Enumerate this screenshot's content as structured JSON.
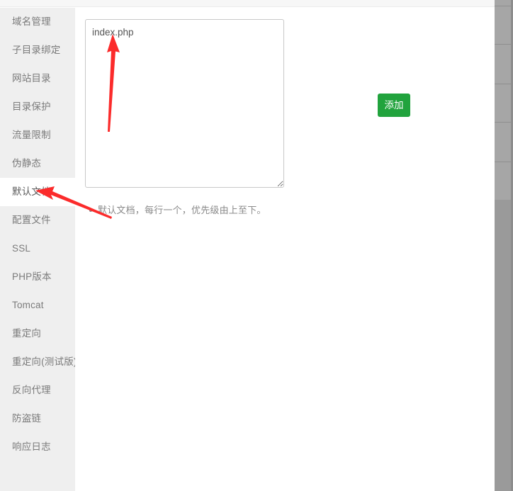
{
  "sidebar": {
    "items": [
      {
        "label": "域名管理",
        "active": false
      },
      {
        "label": "子目录绑定",
        "active": false
      },
      {
        "label": "网站目录",
        "active": false
      },
      {
        "label": "目录保护",
        "active": false
      },
      {
        "label": "流量限制",
        "active": false
      },
      {
        "label": "伪静态",
        "active": false
      },
      {
        "label": "默认文档",
        "active": true
      },
      {
        "label": "配置文件",
        "active": false
      },
      {
        "label": "SSL",
        "active": false
      },
      {
        "label": "PHP版本",
        "active": false
      },
      {
        "label": "Tomcat",
        "active": false
      },
      {
        "label": "重定向",
        "active": false
      },
      {
        "label": "重定向(测试版)",
        "active": false
      },
      {
        "label": "反向代理",
        "active": false
      },
      {
        "label": "防盗链",
        "active": false
      },
      {
        "label": "响应日志",
        "active": false
      }
    ]
  },
  "main": {
    "document_textarea": {
      "value": "index.php",
      "placeholder": ""
    },
    "add_button_label": "添加",
    "hints": [
      "默认文档，每行一个，优先级由上至下。"
    ]
  },
  "annotations": [
    {
      "name": "arrow-to-textarea-value",
      "color": "#fb2b2b"
    },
    {
      "name": "arrow-to-default-document-menu",
      "color": "#fb2b2b"
    }
  ],
  "colors": {
    "accent_green": "#21a33d",
    "sidebar_bg": "#efefef",
    "annotation_red": "#fb2b2b",
    "text_muted": "#7b7b7b"
  }
}
